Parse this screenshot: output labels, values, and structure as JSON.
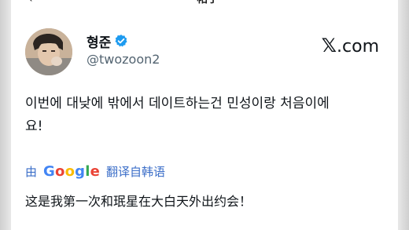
{
  "top_bar": {
    "back_glyph": "‹",
    "title": "帖子"
  },
  "tweet": {
    "author": {
      "name": "형준",
      "handle": "@twozoon2",
      "verified_color": "#1d9bf0"
    },
    "brand": {
      "prefix": "𝕏",
      "suffix": ".com"
    },
    "text_line1": "이번에 대낮에 밖에서 데이트하는건 민성이랑 처음이에",
    "text_line2": "요!",
    "translation": {
      "by": "由",
      "provider": [
        "G",
        "o",
        "o",
        "g",
        "l",
        "e"
      ],
      "label": "翻译自韩语",
      "text": "这是我第一次和珉星在大白天外出约会！"
    }
  },
  "icons": {
    "verified": "verified-badge-icon",
    "back": "back-arrow-icon"
  }
}
